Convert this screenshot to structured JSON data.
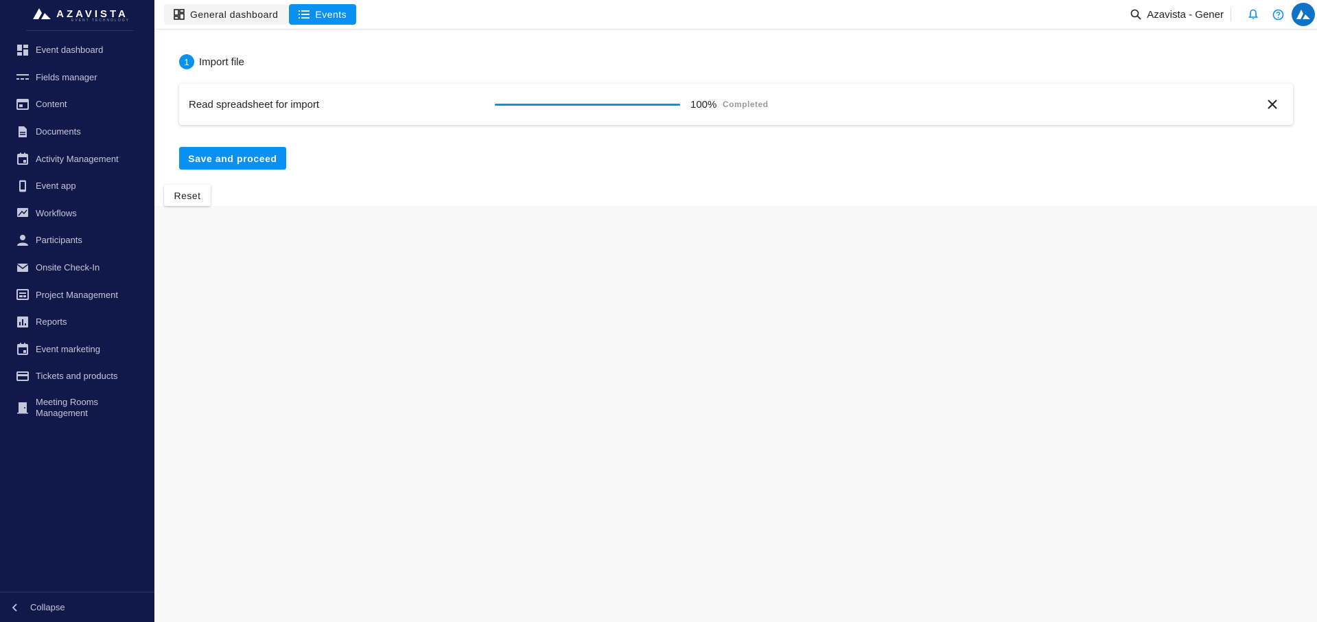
{
  "brand": {
    "name": "AZAVISTA",
    "tagline": "EVENT TECHNOLOGY"
  },
  "sidebar": {
    "items": [
      {
        "label": "Event dashboard",
        "icon": "dashboard-icon"
      },
      {
        "label": "Fields manager",
        "icon": "fields-icon"
      },
      {
        "label": "Content",
        "icon": "content-icon"
      },
      {
        "label": "Documents",
        "icon": "document-icon"
      },
      {
        "label": "Activity Management",
        "icon": "calendar-icon"
      },
      {
        "label": "Event app",
        "icon": "phone-icon"
      },
      {
        "label": "Workflows",
        "icon": "workflow-icon"
      },
      {
        "label": "Participants",
        "icon": "person-icon"
      },
      {
        "label": "Onsite Check-In",
        "icon": "mail-icon"
      },
      {
        "label": "Project Management",
        "icon": "project-icon"
      },
      {
        "label": "Reports",
        "icon": "chart-icon"
      },
      {
        "label": "Event marketing",
        "icon": "calendar-icon"
      },
      {
        "label": "Tickets and products",
        "icon": "card-icon"
      },
      {
        "label": "Meeting Rooms Management",
        "icon": "door-icon"
      }
    ],
    "collapse_label": "Collapse"
  },
  "topbar": {
    "general_dashboard": "General dashboard",
    "events": "Events",
    "search_text": "Azavista - Gener"
  },
  "import": {
    "step_number": "1",
    "step_title": "Import file",
    "task_title": "Read spreadsheet for import",
    "progress": 1.0,
    "progress_label": "100%",
    "status": "Completed"
  },
  "actions": {
    "save_proceed": "Save and proceed",
    "reset": "Reset"
  },
  "colors": {
    "sidebar_bg": "#11194a",
    "accent": "#0891f3"
  }
}
